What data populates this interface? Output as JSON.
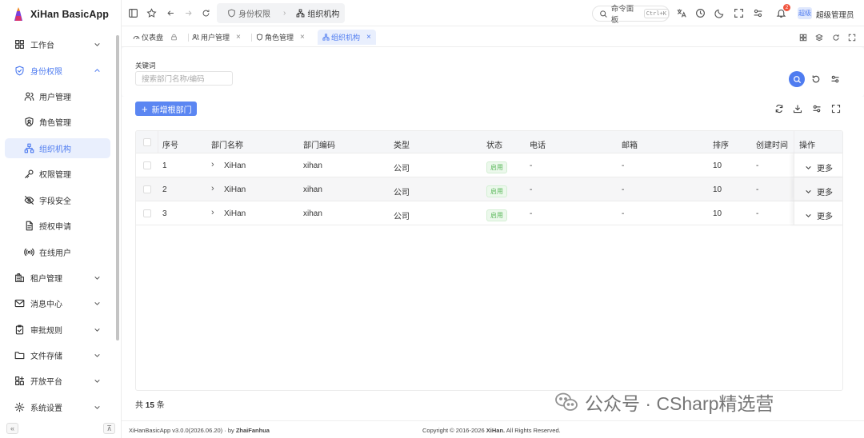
{
  "app": {
    "name": "XiHan BasicApp"
  },
  "sidebar": {
    "items": [
      {
        "label": "工作台",
        "icon": "grid-icon",
        "type": "top",
        "chevron": "down"
      },
      {
        "label": "身份权限",
        "icon": "shield-icon",
        "type": "top",
        "chevron": "up",
        "open": true
      },
      {
        "label": "用户管理",
        "icon": "users-icon",
        "type": "sub"
      },
      {
        "label": "角色管理",
        "icon": "role-shield-icon",
        "type": "sub"
      },
      {
        "label": "组织机构",
        "icon": "org-tree-icon",
        "type": "sub",
        "active": true
      },
      {
        "label": "权限管理",
        "icon": "key-icon",
        "type": "sub"
      },
      {
        "label": "字段安全",
        "icon": "eye-off-icon",
        "type": "sub"
      },
      {
        "label": "授权申请",
        "icon": "document-icon",
        "type": "sub"
      },
      {
        "label": "在线用户",
        "icon": "broadcast-icon",
        "type": "sub"
      },
      {
        "label": "租户管理",
        "icon": "building-icon",
        "type": "top",
        "chevron": "down"
      },
      {
        "label": "消息中心",
        "icon": "mail-icon",
        "type": "top",
        "chevron": "down"
      },
      {
        "label": "审批规则",
        "icon": "clipboard-check-icon",
        "type": "top",
        "chevron": "down"
      },
      {
        "label": "文件存储",
        "icon": "folder-icon",
        "type": "top",
        "chevron": "down"
      },
      {
        "label": "开放平台",
        "icon": "apps-icon",
        "type": "top",
        "chevron": "down"
      },
      {
        "label": "系统设置",
        "icon": "gear-icon",
        "type": "top",
        "chevron": "down"
      }
    ],
    "collapse_label": "«",
    "pin_label": "⊼"
  },
  "header": {
    "breadcrumb": [
      "身份权限",
      "组织机构"
    ],
    "command_label": "命令面板",
    "command_shortcut": "Ctrl+K",
    "notification_count": "2",
    "avatar_text": "超级",
    "user_name": "超级管理员"
  },
  "tabs": [
    {
      "label": "仪表盘",
      "icon": "dashboard-icon",
      "suffix": "lock"
    },
    {
      "label": "用户管理",
      "icon": "users-icon",
      "suffix": "close"
    },
    {
      "label": "角色管理",
      "icon": "role-shield-icon",
      "suffix": "close"
    },
    {
      "label": "组织机构",
      "icon": "org-tree-icon",
      "suffix": "close",
      "active": true
    }
  ],
  "search": {
    "keyword_label": "关键词",
    "keyword_placeholder": "搜索部门名称/编码"
  },
  "toolbar": {
    "add_label": "新增根部门"
  },
  "table": {
    "columns": [
      "序号",
      "部门名称",
      "部门编码",
      "类型",
      "状态",
      "电话",
      "邮箱",
      "排序",
      "创建时间",
      "操作"
    ],
    "rows": [
      {
        "index": "1",
        "name": "XiHan",
        "code": "xihan",
        "type": "公司",
        "status": "启用",
        "phone": "-",
        "email": "-",
        "sort": "10",
        "created": "-",
        "action": "更多"
      },
      {
        "index": "2",
        "name": "XiHan",
        "code": "xihan",
        "type": "公司",
        "status": "启用",
        "phone": "-",
        "email": "-",
        "sort": "10",
        "created": "-",
        "action": "更多"
      },
      {
        "index": "3",
        "name": "XiHan",
        "code": "xihan",
        "type": "公司",
        "status": "启用",
        "phone": "-",
        "email": "-",
        "sort": "10",
        "created": "-",
        "action": "更多"
      }
    ],
    "total_prefix": "共",
    "total_count": "15",
    "total_suffix": "条"
  },
  "watermark": {
    "text": "公众号 · CSharp精选营"
  },
  "footer": {
    "version_prefix": "XiHanBasicApp v3.0.0(2026.06.20) · by",
    "author": "ZhaiFanhua",
    "copyright_prefix": "Copyright © 2016-2026",
    "copyright_owner": "XiHan.",
    "copyright_suffix": "All Rights Reserved."
  },
  "colors": {
    "accent": "#4f7cf0",
    "success": "#5cb85c",
    "danger": "#f0533d"
  }
}
